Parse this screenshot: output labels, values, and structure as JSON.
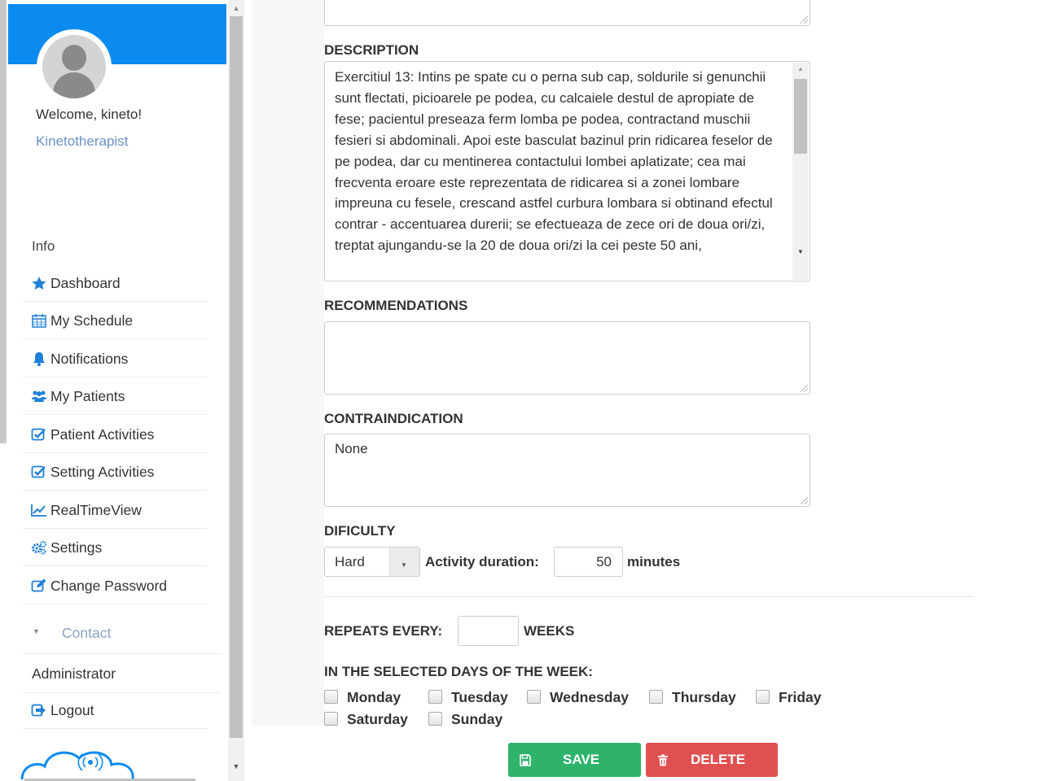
{
  "sidebar": {
    "welcome": "Welcome, kineto!",
    "role": "Kinetotherapist",
    "section_label": "Info",
    "items": [
      {
        "label": "Dashboard",
        "icon": "star-icon"
      },
      {
        "label": "My Schedule",
        "icon": "calendar-icon"
      },
      {
        "label": "Notifications",
        "icon": "bell-icon"
      },
      {
        "label": "My Patients",
        "icon": "users-icon"
      },
      {
        "label": "Patient Activities",
        "icon": "check-square-icon"
      },
      {
        "label": "Setting Activities",
        "icon": "check-square-icon"
      },
      {
        "label": "RealTimeView",
        "icon": "line-chart-icon"
      },
      {
        "label": "Settings",
        "icon": "gears-icon"
      },
      {
        "label": "Change Password",
        "icon": "edit-icon"
      }
    ],
    "contact_label": "Contact",
    "admin_label": "Administrator",
    "logout_label": "Logout",
    "accent_color": "#0b8bf0"
  },
  "form": {
    "description_label": "DESCRIPTION",
    "description_value": "Exercitiul 13: Intins pe spate cu o perna sub cap, soldurile si genunchii sunt flectati, picioarele pe podea, cu calcaiele destul de apropiate de fese; pacientul preseaza ferm lomba pe podea, contractand muschii fesieri si abdominali. Apoi este basculat bazinul prin ridicarea feselor de pe podea, dar cu mentinerea contactului lombei aplatizate; cea mai frecventa eroare este reprezentata de ridicarea si a zonei lombare impreuna cu fesele, crescand astfel curbura lombara si obtinand efectul contrar - accentuarea durerii; se efectueaza de zece ori de doua ori/zi, treptat ajungandu-se la 20 de doua ori/zi la cei peste 50 ani,",
    "recommendations_label": "RECOMMENDATIONS",
    "recommendations_value": "",
    "contraindication_label": "CONTRAINDICATION",
    "contraindication_value": "None",
    "difficulty_label": "DIFICULTY",
    "difficulty_value": "Hard",
    "duration_label": "Activity duration:",
    "duration_value": "50",
    "duration_unit": "minutes",
    "repeats_label": "REPEATS EVERY:",
    "repeats_value": "",
    "repeats_unit": "WEEKS",
    "days_label": "IN THE SELECTED DAYS OF THE WEEK:",
    "days": [
      "Monday",
      "Tuesday",
      "Wednesday",
      "Thursday",
      "Friday",
      "Saturday",
      "Sunday"
    ]
  },
  "actions": {
    "save_label": "SAVE",
    "delete_label": "DELETE",
    "save_color": "#2fb36b",
    "delete_color": "#e05050"
  }
}
